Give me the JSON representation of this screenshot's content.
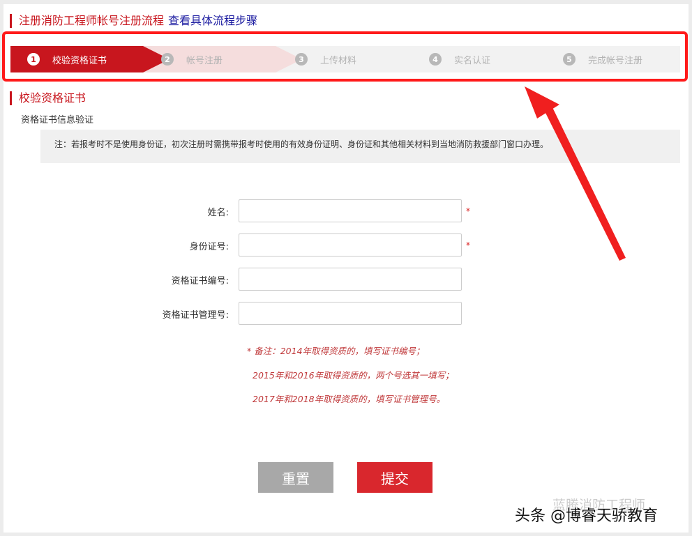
{
  "header": {
    "title": "注册消防工程师帐号注册流程",
    "link": "查看具体流程步骤"
  },
  "steps": [
    {
      "num": "1",
      "label": "校验资格证书",
      "active": true
    },
    {
      "num": "2",
      "label": "帐号注册"
    },
    {
      "num": "3",
      "label": "上传材料"
    },
    {
      "num": "4",
      "label": "实名认证"
    },
    {
      "num": "5",
      "label": "完成帐号注册"
    }
  ],
  "section": {
    "title": "校验资格证书",
    "subtitle": "资格证书信息验证",
    "note": "注：若报考时不是使用身份证，初次注册时需携带报考时使用的有效身份证明、身份证和其他相关材料到当地消防救援部门窗口办理。"
  },
  "form": {
    "name_label": "姓名:",
    "name_value": "",
    "id_label": "身份证号:",
    "id_value": "",
    "cert_no_label": "资格证书编号:",
    "cert_no_value": "",
    "cert_mgmt_label": "资格证书管理号:",
    "cert_mgmt_value": "",
    "required_mark": "*"
  },
  "remarks": {
    "line1": "* 备注：2014年取得资质的，填写证书编号；",
    "line2": "2015年和2016年取得资质的，两个号选其一填写；",
    "line3": "2017年和2018年取得资质的，填写证书管理号。"
  },
  "buttons": {
    "reset": "重置",
    "submit": "提交"
  },
  "watermark": {
    "faint": "蓝腾消防工程师",
    "main": "头条 @博睿天骄教育"
  },
  "colors": {
    "brand_red": "#c8161e",
    "highlight": "#ff1a1a",
    "link_blue": "#1a1aa0"
  }
}
